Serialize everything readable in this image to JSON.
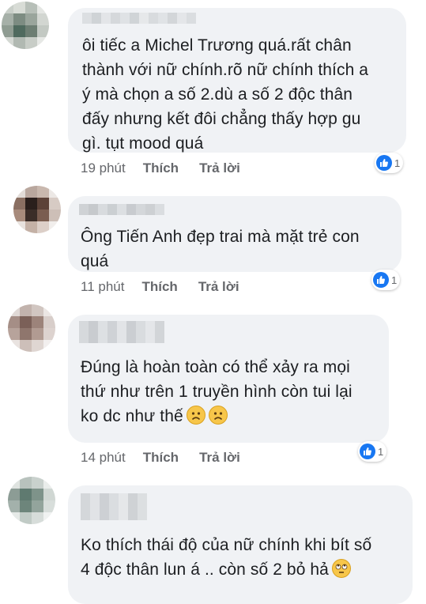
{
  "comments": [
    {
      "text": "ôi tiếc a Michel Trương quá.rất chân\nthành với nữ chính.rõ nữ chính thích a\ný mà chọn a số 2.dù a số 2 độc thân\nđấy nhưng kết đôi chẳng thấy hợp gu\ngì. tụt mood quá",
      "time": "19 phút",
      "like_label": "Thích",
      "reply_label": "Trả lời",
      "reaction_count": "1"
    },
    {
      "text": "Ông Tiến Anh đẹp trai mà mặt trẻ con\nquá",
      "time": "11 phút",
      "like_label": "Thích",
      "reply_label": "Trả lời",
      "reaction_count": "1"
    },
    {
      "text": "Đúng là hoàn toàn có thể xảy ra mọi\nthứ như trên 1 truyền hình còn tui lại\nko dc như thế",
      "time": "14 phút",
      "like_label": "Thích",
      "reply_label": "Trả lời",
      "reaction_count": "1",
      "emojis": [
        "frowning-face-icon",
        "frowning-face-icon"
      ]
    },
    {
      "text": "Ko thích thái độ của nữ chính khi bít số\n4 độc thân lun á .. còn số 2 bỏ hả",
      "emojis": [
        "eye-roll-face-icon"
      ]
    }
  ],
  "colors": {
    "bubble": "#f0f2f5",
    "text": "#1c1e21",
    "secondary": "#65676b",
    "like_blue": "#1877f2"
  }
}
